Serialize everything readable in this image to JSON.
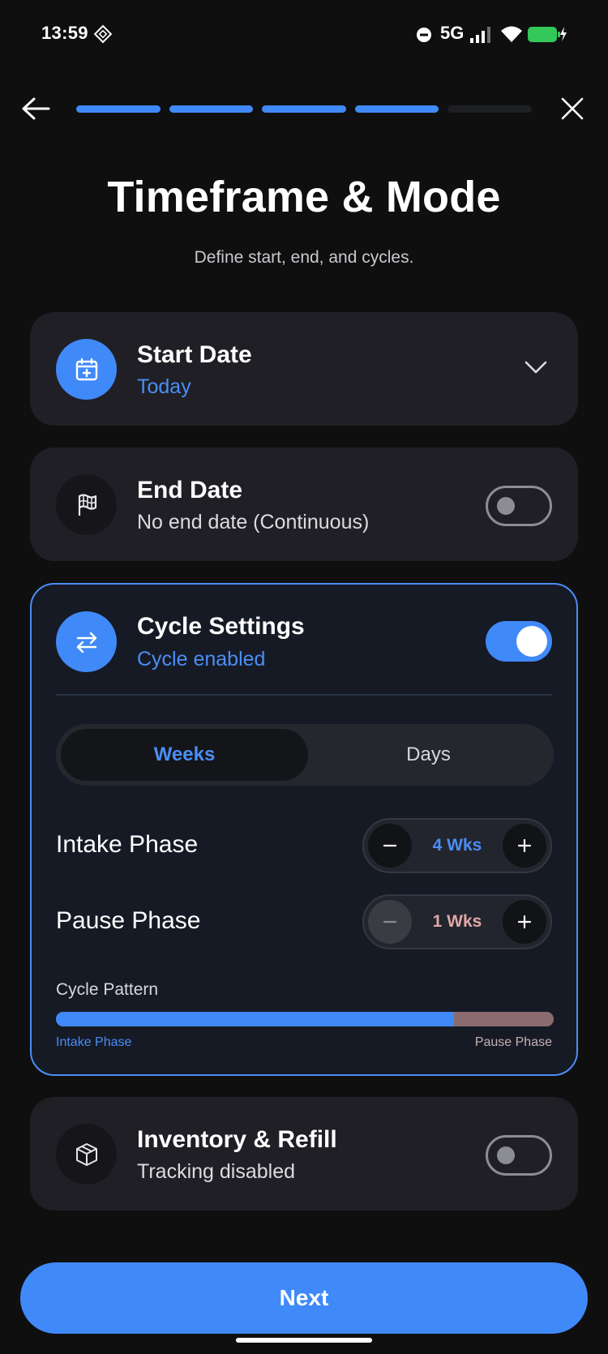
{
  "status_bar": {
    "time": "13:59",
    "network": "5G",
    "colors": {
      "battery": "#34c759"
    },
    "icons": [
      "app-notification-icon",
      "do-not-disturb-icon",
      "signal-icon",
      "wifi-icon",
      "battery-charging-icon"
    ]
  },
  "header": {
    "back_icon": "arrow-left-icon",
    "close_icon": "close-icon",
    "progress": {
      "total_steps": 5,
      "completed_steps": 4
    }
  },
  "page": {
    "title": "Timeframe & Mode",
    "subtitle": "Define start, end, and cycles."
  },
  "start_date": {
    "title": "Start Date",
    "value": "Today",
    "icon": "calendar-plus-icon",
    "dropdown_icon": "chevron-down-icon"
  },
  "end_date": {
    "title": "End Date",
    "value": "No end date (Continuous)",
    "icon": "flag-icon",
    "enabled": false
  },
  "cycle": {
    "title": "Cycle Settings",
    "status": "Cycle enabled",
    "icon": "swap-arrows-icon",
    "enabled": true,
    "unit_options": [
      "Weeks",
      "Days"
    ],
    "selected_unit": "Weeks",
    "intake": {
      "label": "Intake Phase",
      "value": "4 Wks",
      "weeks": 4
    },
    "pause": {
      "label": "Pause Phase",
      "value": "1 Wks",
      "weeks": 1
    },
    "pattern": {
      "title": "Cycle Pattern",
      "intake_label": "Intake Phase",
      "pause_label": "Pause Phase",
      "intake_fraction": 0.8
    }
  },
  "inventory": {
    "title": "Inventory & Refill",
    "status": "Tracking disabled",
    "icon": "box-icon",
    "enabled": false
  },
  "footer": {
    "next_label": "Next"
  },
  "colors": {
    "accent": "#4089f8",
    "background": "#0f0f10",
    "card": "#1f1f25",
    "pause_phase": "#8a6b6e"
  }
}
